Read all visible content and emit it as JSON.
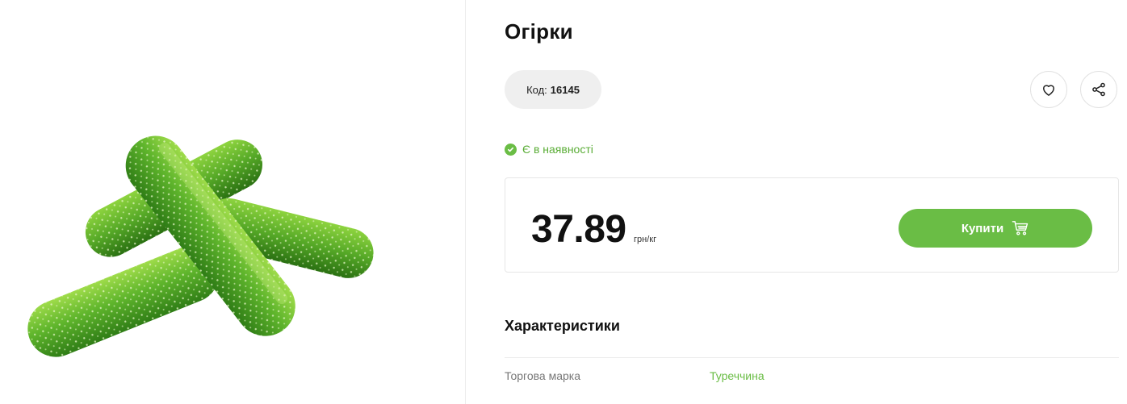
{
  "product": {
    "title": "Огірки",
    "code_label": "Код:",
    "code_value": "16145",
    "image_alt": "cucumbers-image",
    "stock_text": "Є в наявності",
    "price": "37.89",
    "price_unit": "грн/кг",
    "buy_label": "Купити"
  },
  "actions": {
    "favorite_icon": "heart-icon",
    "share_icon": "share-icon"
  },
  "specs": {
    "title": "Характеристики",
    "rows": [
      {
        "key": "Торгова марка",
        "value": "Туреччина"
      }
    ]
  },
  "colors": {
    "accent": "#6abd45",
    "stock_text": "#5aad36",
    "pill_bg": "#efefef"
  }
}
